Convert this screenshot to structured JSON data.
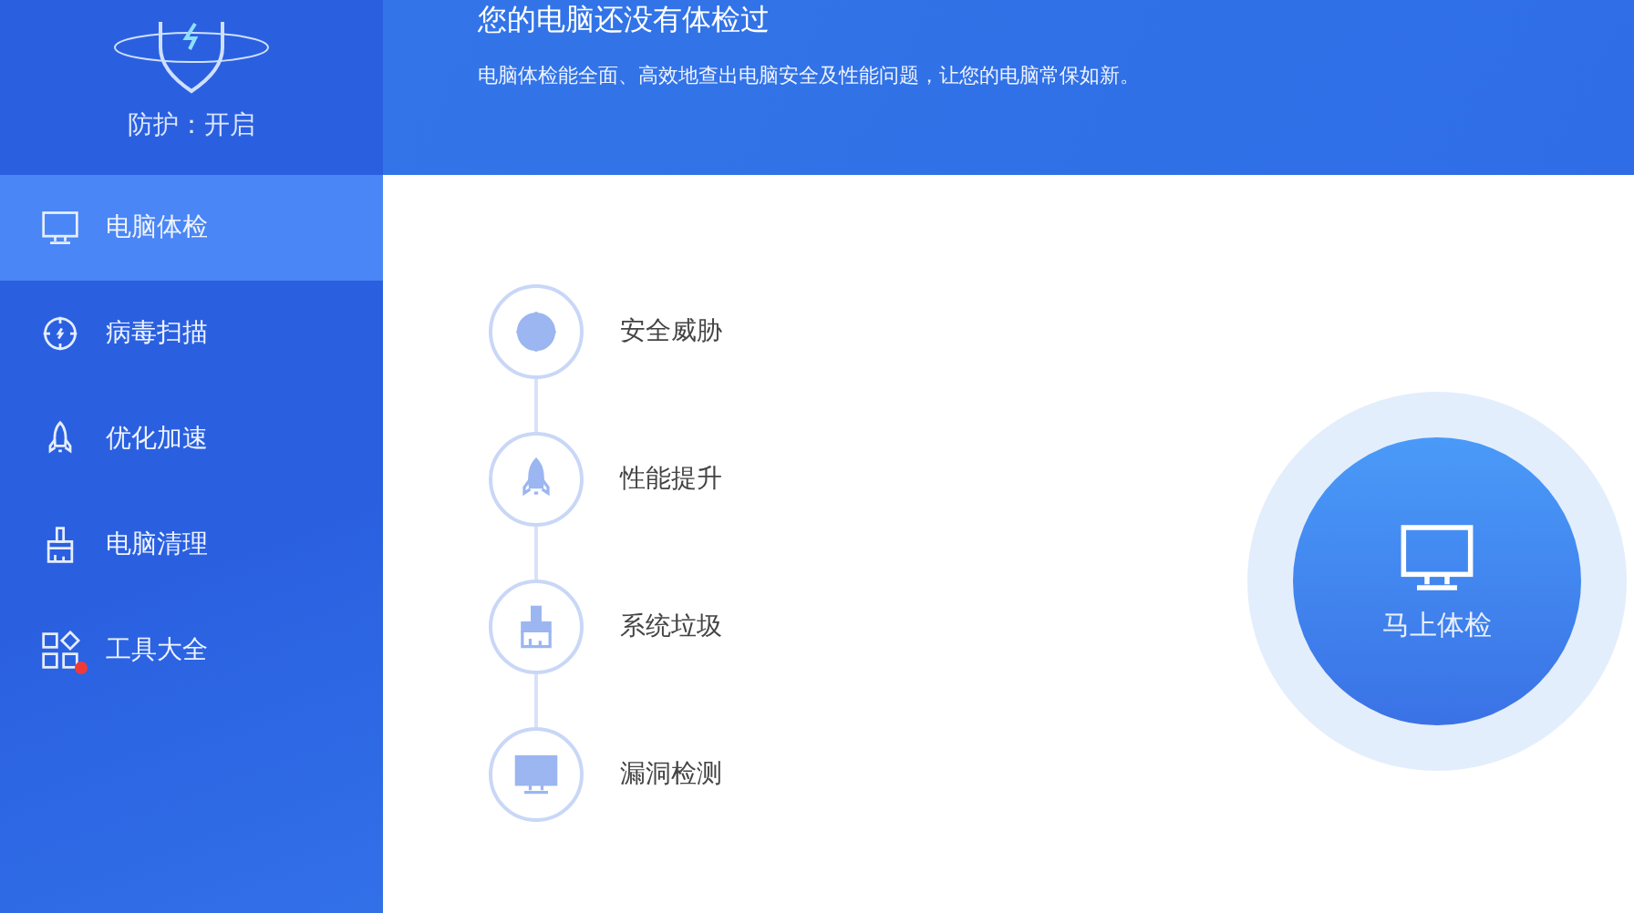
{
  "protection": {
    "label": "防护：开启"
  },
  "header": {
    "title": "您的电脑还没有体检过",
    "subtitle": "电脑体检能全面、高效地查出电脑安全及性能问题，让您的电脑常保如新。"
  },
  "sidebar": {
    "items": [
      {
        "label": "电脑体检",
        "kind": "monitor",
        "selected": true,
        "badge": false
      },
      {
        "label": "病毒扫描",
        "kind": "scan",
        "selected": false,
        "badge": false
      },
      {
        "label": "优化加速",
        "kind": "rocket",
        "selected": false,
        "badge": false
      },
      {
        "label": "电脑清理",
        "kind": "brush",
        "selected": false,
        "badge": false
      },
      {
        "label": "工具大全",
        "kind": "tools",
        "selected": false,
        "badge": true
      }
    ]
  },
  "checks": [
    {
      "label": "安全威胁",
      "kind": "scan"
    },
    {
      "label": "性能提升",
      "kind": "rocket"
    },
    {
      "label": "系统垃圾",
      "kind": "brush"
    },
    {
      "label": "漏洞检测",
      "kind": "monitor"
    }
  ],
  "start_button": {
    "label": "马上体检"
  }
}
